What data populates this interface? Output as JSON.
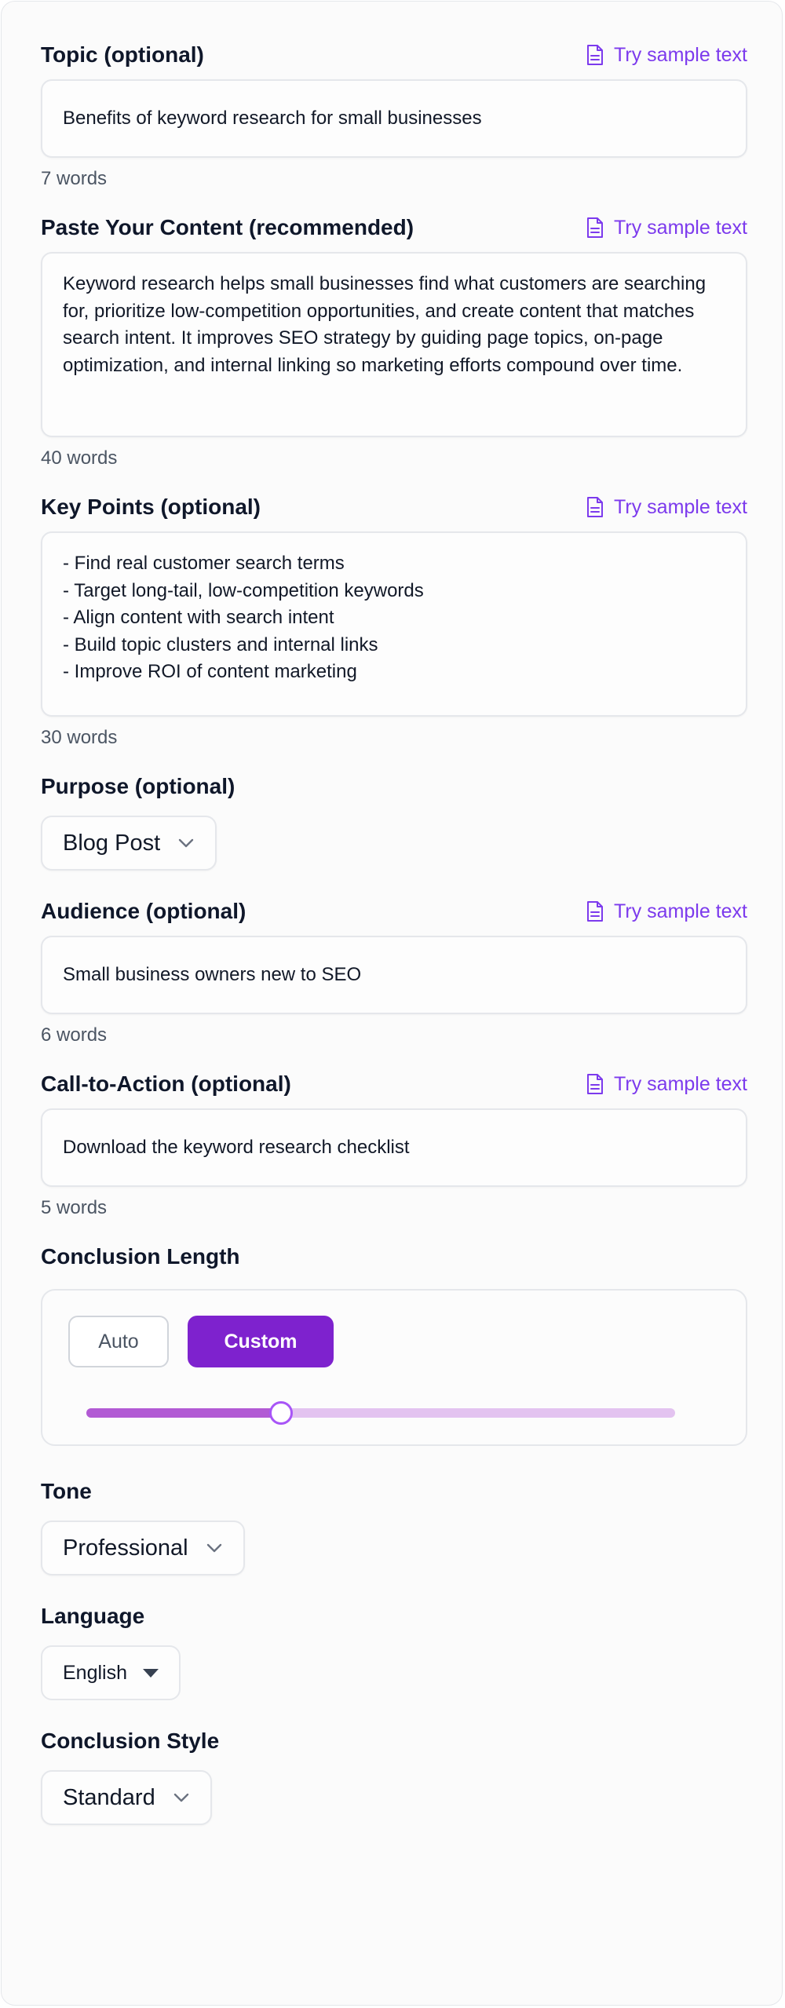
{
  "sample_link_label": "Try sample text",
  "topic": {
    "label": "Topic (optional)",
    "value": "Benefits of keyword research for small businesses",
    "count": "7 words"
  },
  "content": {
    "label": "Paste Your Content (recommended)",
    "value": "Keyword research helps small businesses find what customers are searching for, prioritize low-competition opportunities, and create content that matches search intent. It improves SEO strategy by guiding page topics, on-page optimization, and internal linking so marketing efforts compound over time.",
    "count": "40 words"
  },
  "key_points": {
    "label": "Key Points (optional)",
    "value": "- Find real customer search terms\n- Target long-tail, low-competition keywords\n- Align content with search intent\n- Build topic clusters and internal links\n- Improve ROI of content marketing",
    "count": "30 words"
  },
  "purpose": {
    "label": "Purpose (optional)",
    "selected": "Blog Post"
  },
  "audience": {
    "label": "Audience (optional)",
    "value": "Small business owners new to SEO",
    "count": "6 words"
  },
  "cta": {
    "label": "Call-to-Action (optional)",
    "value": "Download the keyword research checklist",
    "count": "5 words"
  },
  "conclusion_length": {
    "label": "Conclusion Length",
    "auto_label": "Auto",
    "custom_label": "Custom",
    "active_mode": "Custom",
    "slider_fraction": 0.33
  },
  "tone": {
    "label": "Tone",
    "selected": "Professional"
  },
  "language": {
    "label": "Language",
    "selected": "English"
  },
  "conclusion_style": {
    "label": "Conclusion Style",
    "selected": "Standard"
  },
  "colors": {
    "accent": "#7c3aed",
    "button_active": "#7e22ce",
    "slider_fill": "#b25ad4",
    "slider_track": "#e3c3f0"
  },
  "icons": {
    "sample": "document-icon",
    "dropdown": "chevron-down-icon",
    "language_dropdown": "caret-down-icon"
  }
}
